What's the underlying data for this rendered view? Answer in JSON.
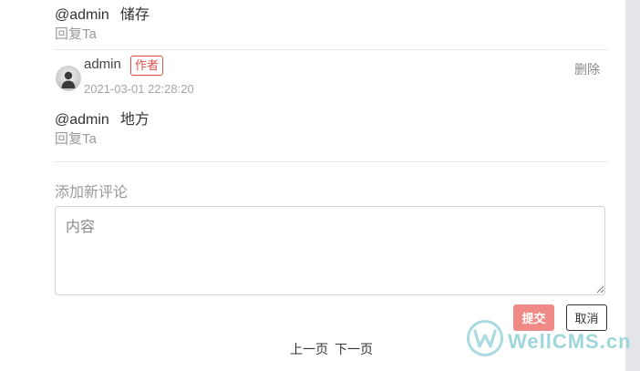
{
  "comments": [
    {
      "mention": "@admin",
      "text": "储存",
      "reply_label": "回复Ta"
    },
    {
      "author": "admin",
      "badge": "作者",
      "time": "2021-03-01 22:28:20",
      "delete_label": "删除",
      "mention": "@admin",
      "text": "地方",
      "reply_label": "回复Ta"
    }
  ],
  "new_comment": {
    "label": "添加新评论",
    "placeholder": "内容",
    "submit_label": "提交",
    "cancel_label": "取消"
  },
  "pagination": {
    "prev_label": "上一页",
    "next_label": "下一页"
  },
  "watermark": {
    "text": "WellCMS.cn"
  },
  "colors": {
    "badge": "#d9534f",
    "submit": "#ef8a86",
    "watermark": "#9fd6dc"
  }
}
